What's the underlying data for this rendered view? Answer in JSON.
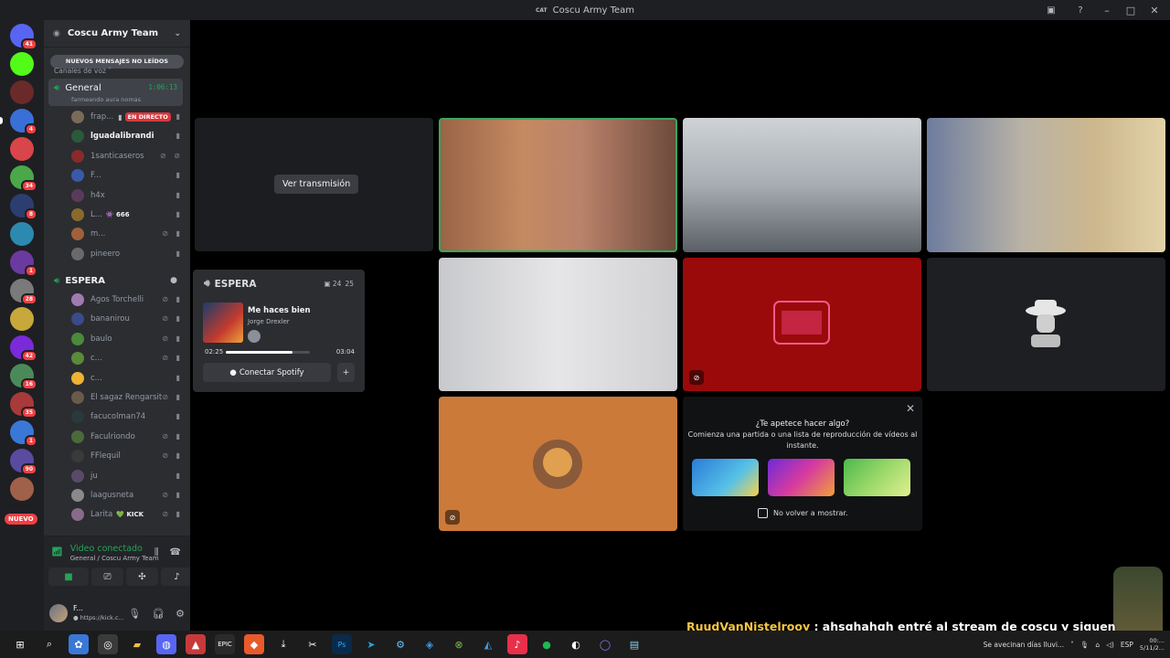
{
  "window": {
    "title": "Coscu Army Team",
    "prefix": "CAT"
  },
  "servers": [
    {
      "name": "discord-home",
      "badge": "41",
      "color": "#5865f2"
    },
    {
      "name": "kick",
      "badge": "",
      "color": "#53fc18"
    },
    {
      "name": "server-3",
      "badge": "",
      "color": "#6b2a2a"
    },
    {
      "name": "cat-server",
      "badge": "4",
      "color": "#3a6fd8"
    },
    {
      "name": "server-5",
      "badge": "",
      "color": "#d8454a"
    },
    {
      "name": "server-6",
      "badge": "34",
      "color": "#4aa84a"
    },
    {
      "name": "olv",
      "badge": "8",
      "color": "#2c3e70"
    },
    {
      "name": "server-8",
      "badge": "",
      "color": "#2c8ab0"
    },
    {
      "name": "server-9",
      "badge": "1",
      "color": "#6a3aa0"
    },
    {
      "name": "server-10",
      "badge": "28",
      "color": "#7a7a7a"
    },
    {
      "name": "server-11",
      "badge": "",
      "color": "#c8a83a"
    },
    {
      "name": "server-12",
      "badge": "42",
      "color": "#7a2ad8"
    },
    {
      "name": "server-13",
      "badge": "16",
      "color": "#4a8a5a"
    },
    {
      "name": "server-14",
      "badge": "35",
      "color": "#a83a3a"
    },
    {
      "name": "server-15",
      "badge": "1",
      "color": "#3a78d8"
    },
    {
      "name": "server-16",
      "badge": "90",
      "color": "#5a4aa0"
    },
    {
      "name": "server-17",
      "badge": "",
      "color": "#a0604a"
    }
  ],
  "nuevo_label": "NUEVO",
  "guild": {
    "name": "Coscu Army Team",
    "unread_pill": "NUEVOS MENSAJES NO LEÍDOS",
    "category": "Canales de voz ˅"
  },
  "general": {
    "name": "General",
    "timer": "1:06:13",
    "status": "farmeando aura nomas"
  },
  "general_users": [
    {
      "name": "frap...",
      "live": "EN DIRECTO",
      "bold": false,
      "icons": "▮",
      "color": "#7a6a5a"
    },
    {
      "name": "lguadalibrandi",
      "bold": true,
      "icons": "▮",
      "color": "#2a5a3a"
    },
    {
      "name": "1santicaseros",
      "bold": false,
      "icons": "⊘ ⊘",
      "color": "#8a2a2a"
    },
    {
      "name": "F...",
      "bold": false,
      "icons": "▮",
      "color": "#3a5aa8"
    },
    {
      "name": "h4x",
      "bold": false,
      "icons": "▮",
      "color": "#5a3a5a"
    },
    {
      "name": "L...",
      "extra": "👾 666",
      "bold": false,
      "icons": "▮",
      "color": "#8a6a2a"
    },
    {
      "name": "m...",
      "bold": false,
      "icons": "⊘ ▮",
      "color": "#a0603a"
    },
    {
      "name": "pineero",
      "bold": false,
      "icons": "▮",
      "color": "#6a6a6a"
    }
  ],
  "espera": {
    "name": "ESPERA"
  },
  "espera_users": [
    {
      "name": "Agos Torchelli",
      "icons": "⊘ ▮",
      "color": "#a07ab0"
    },
    {
      "name": "bananirou",
      "icons": "⊘ ▮",
      "color": "#3a4a8a"
    },
    {
      "name": "baulo",
      "icons": "⊘ ▮",
      "color": "#4a8a3a"
    },
    {
      "name": "c...",
      "icons": "⊘ ▮",
      "color": "#5a8a3a"
    },
    {
      "name": "c...",
      "icons": "▮",
      "color": "#f0b232"
    },
    {
      "name": "El sagaz Rengarsit...",
      "icons": "⊘ ▮",
      "color": "#6a5a4a"
    },
    {
      "name": "facucolman74",
      "icons": "▮",
      "color": "#2a3a3a"
    },
    {
      "name": "Faculriondo",
      "icons": "⊘ ▮",
      "color": "#4a6a3a"
    },
    {
      "name": "FFlequil",
      "icons": "⊘ ▮",
      "color": "#3a3a3a"
    },
    {
      "name": "ju",
      "icons": "▮",
      "color": "#5a4a6a"
    },
    {
      "name": "laagusneta",
      "icons": "⊘ ▮",
      "color": "#8a8a8a"
    },
    {
      "name": "Larita",
      "kick": "💚 KICK",
      "icons": "⊘ ▮",
      "color": "#8a6a8a"
    }
  ],
  "voice": {
    "status": "Video conectado",
    "path": "General / Coscu Army Team"
  },
  "user": {
    "name": "F...",
    "status": "● https://kick.c..."
  },
  "stream": {
    "watch_label": "Ver transmisión"
  },
  "spotify": {
    "channel": "ESPERA",
    "count_a": "▣ 24",
    "count_b": "25",
    "track": "Me haces bien",
    "artist": "Jorge Drexler",
    "elapsed": "02:25",
    "total": "03:04",
    "progress": 0.79,
    "connect_label": "Conectar Spotify"
  },
  "activity": {
    "title": "¿Te apetece hacer algo?",
    "subtitle": "Comienza una partida o una lista de reproducción de vídeos al instante.",
    "dont_show": "No volver a mostrar."
  },
  "chat": {
    "user": "RuudVanNistelrooy",
    "message": " : ahsghahgh entré al stream de coscu y siguen hablando de lo mismo"
  },
  "taskbar": {
    "ticker": "Se avecinan días lluvi...",
    "lang": "ESP",
    "time": "00:...",
    "date": "5/11/2..."
  }
}
